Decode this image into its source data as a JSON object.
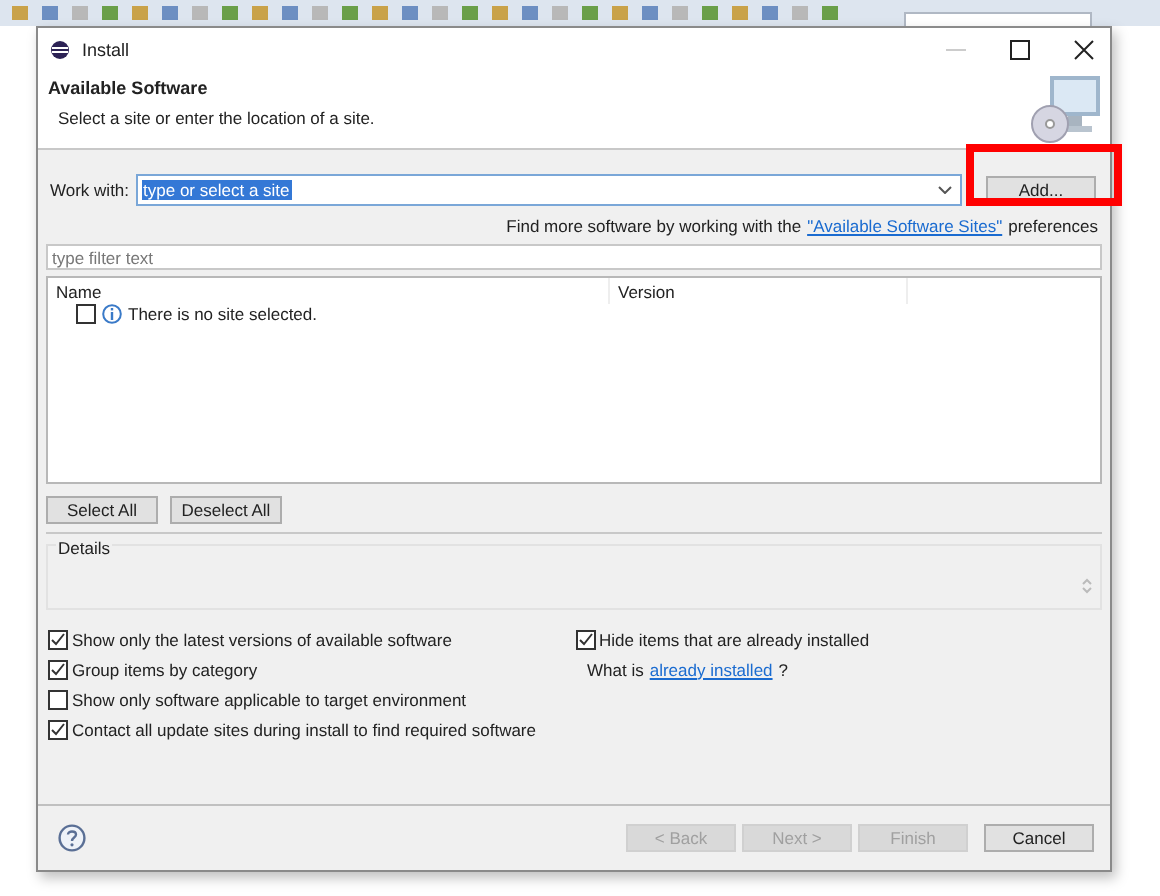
{
  "window": {
    "title": "Install"
  },
  "header": {
    "title": "Available Software",
    "subtitle": "Select a site or enter the location of a site."
  },
  "work_with": {
    "label": "Work with:",
    "value": "type or select a site",
    "value_selected": true,
    "button": "Add...",
    "highlighted": true
  },
  "more_info": {
    "text": "Find more software by working with the",
    "link": "\"Available Software Sites\"",
    "suffix": "preferences"
  },
  "filter": {
    "placeholder": "type filter text"
  },
  "table": {
    "columns": [
      "Name",
      "Version"
    ],
    "rows": [
      {
        "checked": false,
        "text": "There is no site selected."
      }
    ]
  },
  "selection_buttons": [
    "Select All",
    "Deselect All"
  ],
  "details": {
    "label": "Details"
  },
  "options": [
    {
      "label": "Show only the latest versions of available software",
      "checked": true
    },
    {
      "label": "Group items by category",
      "checked": true
    },
    {
      "label": "Show only software applicable to target environment",
      "checked": false
    },
    {
      "label": "Contact all update sites during install to find required software",
      "checked": true
    }
  ],
  "right_options": {
    "hide_installed": {
      "label": "Hide items that are already installed",
      "checked": true
    },
    "what_is": "What is",
    "link": "already installed",
    "question": "?"
  },
  "footer_buttons": [
    {
      "label": "< Back",
      "disabled": true
    },
    {
      "label": "Next >",
      "disabled": true
    },
    {
      "label": "Finish",
      "disabled": true
    },
    {
      "label": "Cancel",
      "disabled": false
    }
  ]
}
